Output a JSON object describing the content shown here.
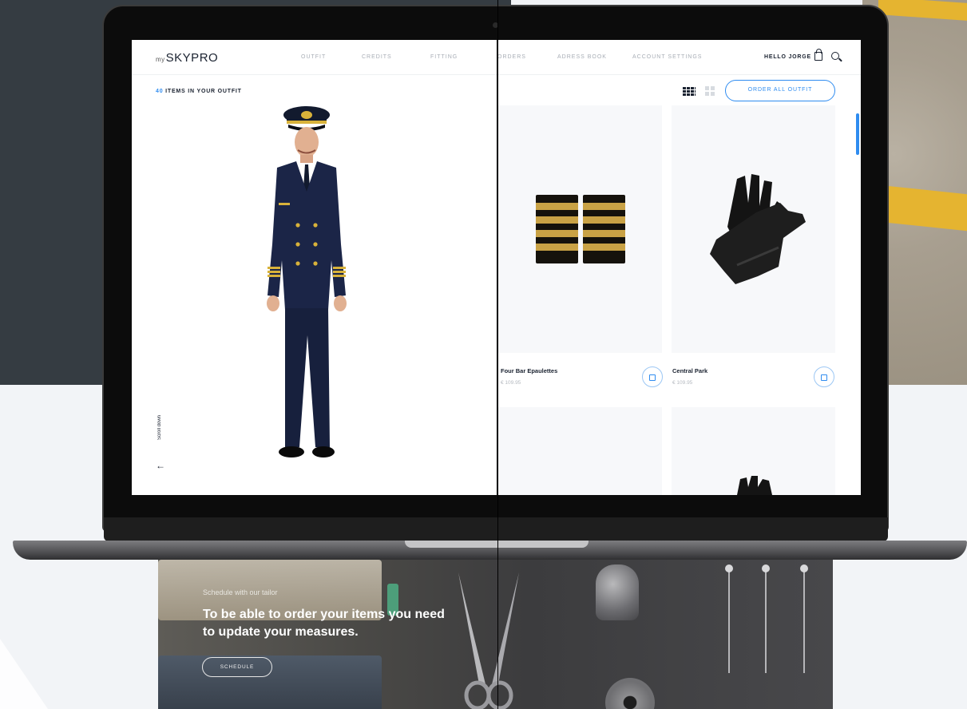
{
  "brand": {
    "prefix": "my",
    "name": "SKYPRO"
  },
  "nav": {
    "items": [
      "OUTFIT",
      "CREDITS",
      "FITTING",
      "ORDERS",
      "ADRESS BOOK",
      "ACCOUNT SETTINGS"
    ],
    "greeting": "HELLO JORGE"
  },
  "outfit": {
    "count": "40",
    "label": "ITEMS IN YOUR OUTFIT"
  },
  "scroll": {
    "label": "Scroll down"
  },
  "grid": {
    "order_button": "ORDER ALL OUTFIT"
  },
  "products": [
    {
      "name": "Four Bar Epaulettes",
      "price": "€ 109.95"
    },
    {
      "name": "Central Park",
      "price": "€ 109.95"
    }
  ],
  "tailor": {
    "eyebrow": "Schedule with our tailor",
    "message": "To be able to order your items you need to update your measures.",
    "button": "SCHEDULE"
  },
  "colors": {
    "accent": "#2f8cf0",
    "navy": "#1a2230",
    "gold": "#d8b23a"
  }
}
